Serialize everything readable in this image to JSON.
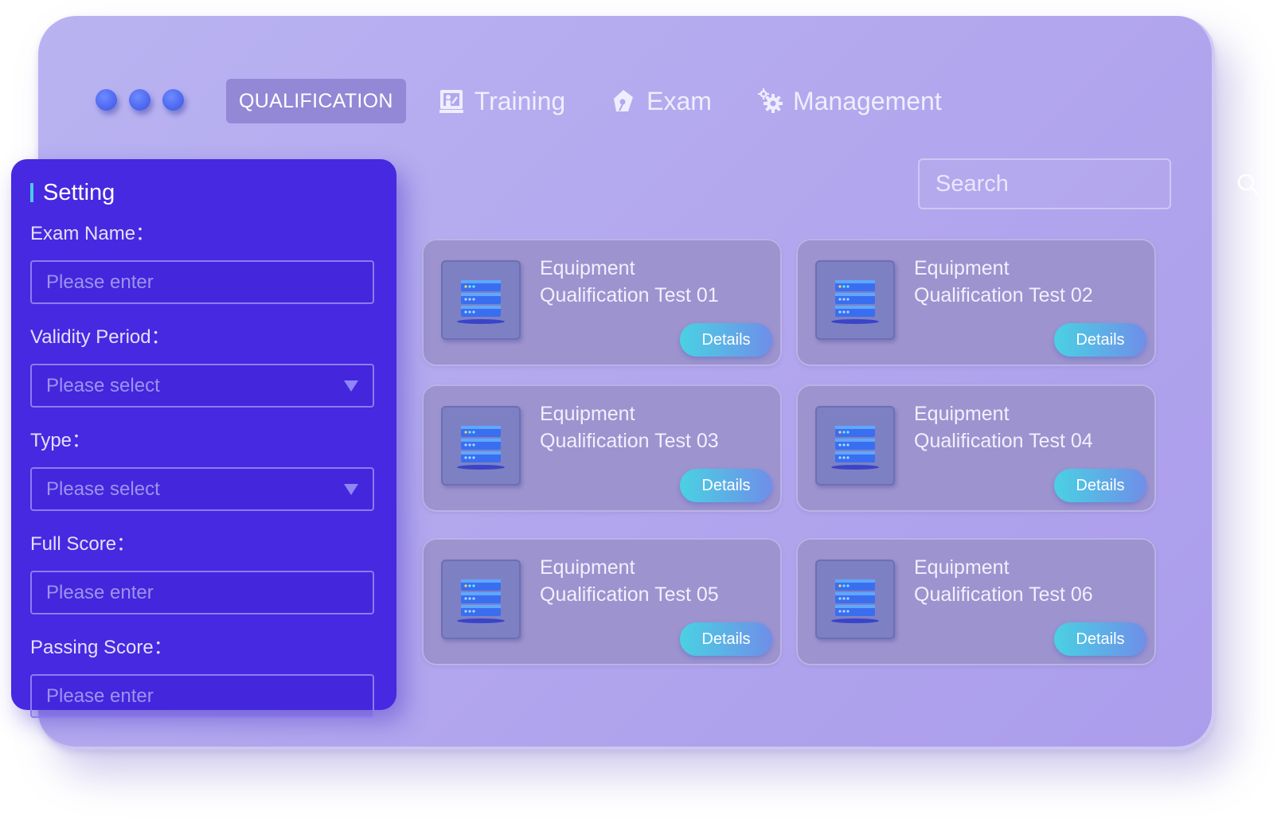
{
  "nav": {
    "tabs": [
      {
        "label": "QUALIFICATION",
        "icon": "",
        "active": true
      },
      {
        "label": "Training",
        "icon": "training-board-icon"
      },
      {
        "label": "Exam",
        "icon": "pen-nib-icon"
      },
      {
        "label": "Management",
        "icon": "gears-icon"
      }
    ]
  },
  "search": {
    "placeholder": "Search",
    "icon": "search-icon"
  },
  "setting": {
    "title": "Setting",
    "fields": [
      {
        "label": "Exam Name：",
        "placeholder": "Please enter",
        "kind": "input"
      },
      {
        "label": "Validity Period：",
        "placeholder": "Please select",
        "kind": "select"
      },
      {
        "label": "Type：",
        "placeholder": "Please select",
        "kind": "select"
      },
      {
        "label": "Full Score：",
        "placeholder": "Please enter",
        "kind": "input"
      },
      {
        "label": "Passing Score：",
        "placeholder": "Please enter",
        "kind": "input"
      }
    ]
  },
  "cards": [
    {
      "line1": "Equipment",
      "line2": "Qualification Test 01",
      "button": "Details",
      "icon": "server-icon"
    },
    {
      "line1": "Equipment",
      "line2": "Qualification Test 02",
      "button": "Details",
      "icon": "server-icon"
    },
    {
      "line1": "Equipment",
      "line2": "Qualification Test 03",
      "button": "Details",
      "icon": "server-icon"
    },
    {
      "line1": "Equipment",
      "line2": "Qualification Test 04",
      "button": "Details",
      "icon": "server-icon"
    },
    {
      "line1": "Equipment",
      "line2": "Qualification Test 05",
      "button": "Details",
      "icon": "server-icon"
    },
    {
      "line1": "Equipment",
      "line2": "Qualification Test 06",
      "button": "Details",
      "icon": "server-icon"
    }
  ],
  "colors": {
    "window": "#b4a8ef",
    "panel": "#4629e0",
    "accent": "#4ec9e8",
    "card": "#9c93cf",
    "dot": "#4a63ee"
  }
}
